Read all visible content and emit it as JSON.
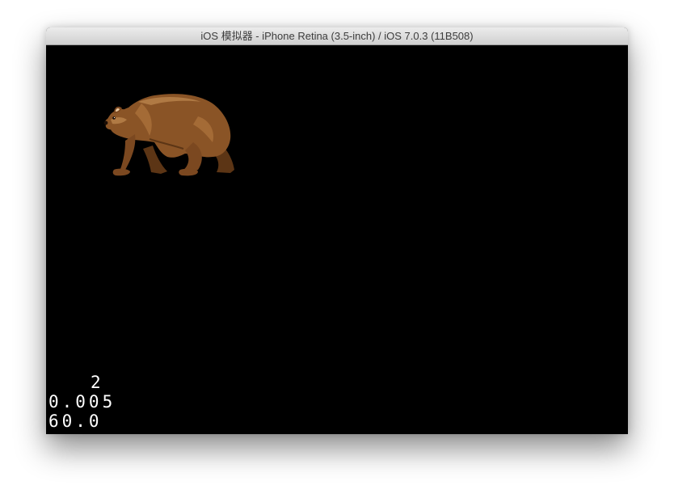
{
  "window": {
    "title": "iOS 模拟器 - iPhone Retina (3.5-inch) / iOS 7.0.3 (11B508)"
  },
  "screen": {
    "background_color": "#000000",
    "sprite": {
      "name": "bear-sprite",
      "icon": "brown-bear-icon"
    },
    "debug_stats": {
      "draw_calls": "2",
      "seconds_per_frame": "0.005",
      "fps": "60.0"
    }
  }
}
